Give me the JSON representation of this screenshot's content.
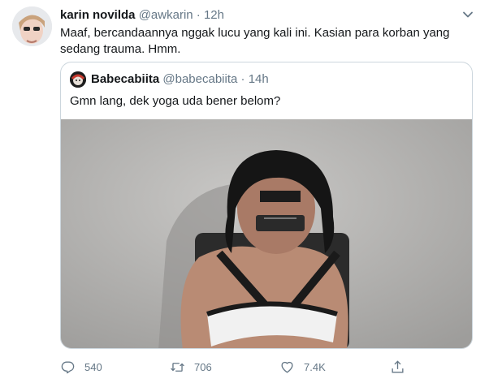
{
  "tweet": {
    "author_name": "karin novilda",
    "author_handle": "@awkarin",
    "separator": "·",
    "time": "12h",
    "text": "Maaf, bercandaannya nggak lucu yang kali ini. Kasian para korban yang sedang trauma. Hmm."
  },
  "quoted": {
    "author_name": "Babecabiita",
    "author_handle": "@babecabiita",
    "separator": "·",
    "time": "14h",
    "text": "Gmn lang, dek yoga uda bener belom?"
  },
  "actions": {
    "reply_count": "540",
    "retweet_count": "706",
    "like_count": "7.4K"
  },
  "icons": [
    "chevron-down-icon",
    "reply-icon",
    "retweet-icon",
    "like-icon",
    "share-icon"
  ],
  "colors": {
    "text": "#14171a",
    "secondary": "#657786",
    "border": "#ccd6dd"
  }
}
